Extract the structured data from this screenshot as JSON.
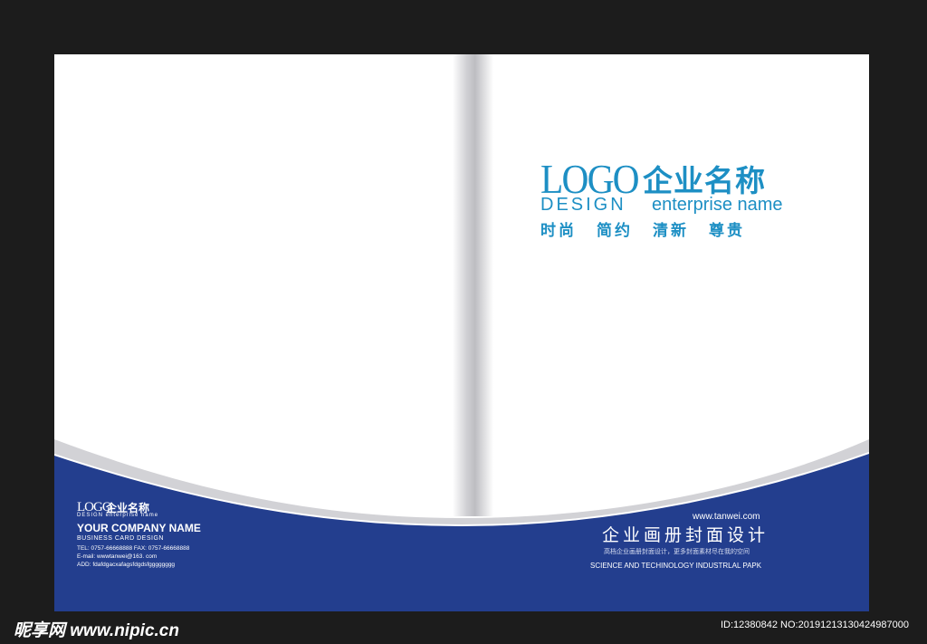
{
  "colors": {
    "outer_background": "#1c1c1c",
    "page": "#ffffff",
    "accent_blue": "#1d8fc4",
    "band_blue": "#233e8e",
    "band_grey": "#d2d2d6"
  },
  "right_page": {
    "logo": {
      "word": "LOGO",
      "name_cn": "企业名称",
      "design": "DESIGN",
      "enterprise_name": "enterprise name",
      "slogans": [
        "时尚",
        "简约",
        "清新",
        "尊贵"
      ]
    },
    "bottom": {
      "url": "www.tanwei.com",
      "title_cn": "企业画册封面设计",
      "subtitle_cn": "高档企业画册封面设计，更多封面素材尽在我的空间",
      "english_line": "SCIENCE AND TECHINOLOGY INDUSTRLAL PAPK"
    }
  },
  "left_page": {
    "logo_word": "LOGO",
    "logo_cn": "企业名称",
    "logo_design": "DESIGN enterprise name",
    "company_name": "YOUR COMPANY NAME",
    "business_card": "BUSINESS CARD DESIGN",
    "contacts": [
      "TEL: 0757-66668888 FAX: 0757-66668888",
      "E-mail: wwwtanwei@163. com",
      "ADD: fdafdgacxafagsfdgdsfgggggggg"
    ]
  },
  "watermark": {
    "site": "昵享网 www.nipic.cn",
    "id_line": "ID:12380842 NO:20191213130424987000"
  }
}
